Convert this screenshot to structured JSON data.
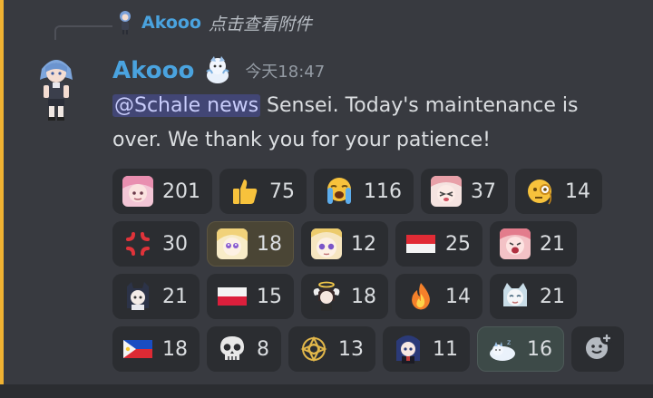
{
  "reply": {
    "author": "Akooo",
    "text": "点击查看附件"
  },
  "message": {
    "author": "Akooo",
    "timestamp": "今天18:47",
    "mention": "@Schale news",
    "text": " Sensei. Today's maintenance is over. We thank you for your patience!"
  },
  "colors": {
    "highlight": "#f0b232",
    "author": "#4aa3df",
    "mention_bg": "#414779"
  },
  "reactions": [
    [
      {
        "icon": "pink-hair-girl-emoji",
        "count": "201"
      },
      {
        "icon": "thumbs-up-emoji",
        "count": "75"
      },
      {
        "icon": "loudly-crying-face-emoji",
        "count": "116"
      },
      {
        "icon": "flustered-girl-emoji",
        "count": "37"
      },
      {
        "icon": "face-with-monocle-emoji",
        "count": "14"
      }
    ],
    [
      {
        "icon": "anger-symbol-emoji",
        "count": "30"
      },
      {
        "icon": "blonde-girl-emoji",
        "count": "18",
        "active": true
      },
      {
        "icon": "blonde-girl-closeup-emoji",
        "count": "12"
      },
      {
        "icon": "indonesia-flag-emoji",
        "count": "25"
      },
      {
        "icon": "shouting-pink-girl-emoji",
        "count": "21"
      }
    ],
    [
      {
        "icon": "dark-hair-girl-emoji",
        "count": "21"
      },
      {
        "icon": "poland-flag-emoji",
        "count": "15"
      },
      {
        "icon": "angel-girl-emoji",
        "count": "18"
      },
      {
        "icon": "fire-emoji",
        "count": "14"
      },
      {
        "icon": "cat-girl-emoji",
        "count": "21"
      }
    ],
    [
      {
        "icon": "philippines-flag-emoji",
        "count": "18"
      },
      {
        "icon": "skull-emoji",
        "count": "8"
      },
      {
        "icon": "halo-emblem-emoji",
        "count": "13"
      },
      {
        "icon": "blue-hair-girl-emoji",
        "count": "11"
      },
      {
        "icon": "sleeping-creature-emoji",
        "count": "16",
        "active2": true
      }
    ]
  ],
  "add_reaction": {
    "icon": "add-reaction-icon"
  }
}
